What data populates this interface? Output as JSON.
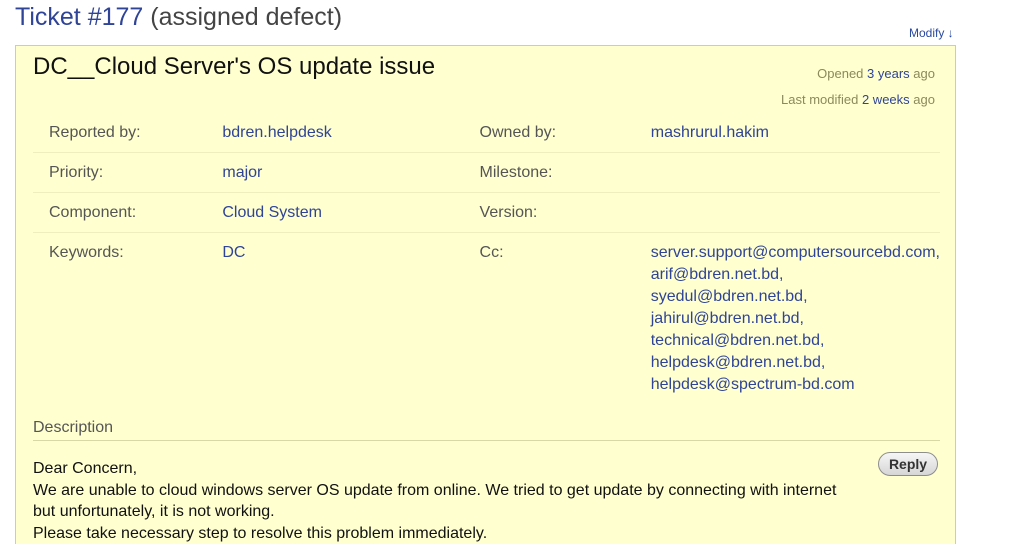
{
  "header": {
    "ticket_number": "Ticket #177",
    "ticket_type": "(assigned defect)",
    "modify_link": "Modify ↓"
  },
  "ticket": {
    "summary": "DC__Cloud Server's OS update issue",
    "opened_label": "Opened",
    "opened_value": "3 years",
    "opened_suffix": "ago",
    "modified_label": "Last modified",
    "modified_value": "2 weeks",
    "modified_suffix": "ago"
  },
  "properties": {
    "reported_by_label": "Reported by:",
    "reported_by": "bdren.helpdesk",
    "owned_by_label": "Owned by:",
    "owned_by": "mashrurul.hakim",
    "priority_label": "Priority:",
    "priority": "major",
    "milestone_label": "Milestone:",
    "milestone": "",
    "component_label": "Component:",
    "component": "Cloud System",
    "version_label": "Version:",
    "version": "",
    "keywords_label": "Keywords:",
    "keywords": "DC",
    "cc_label": "Cc:",
    "cc": [
      "server.support@computersourcebd.com,",
      "arif@bdren.net.bd,",
      "syedul@bdren.net.bd,",
      "jahirul@bdren.net.bd,",
      "technical@bdren.net.bd,",
      "helpdesk@bdren.net.bd,",
      "helpdesk@spectrum-bd.com"
    ]
  },
  "description": {
    "heading": "Description",
    "reply_label": "Reply",
    "lines": [
      "Dear Concern,",
      "We are unable to cloud windows server OS update from online. We tried to get update by connecting with internet",
      "but unfortunately, it is not working.",
      "Please take necessary step to resolve this problem immediately."
    ]
  }
}
